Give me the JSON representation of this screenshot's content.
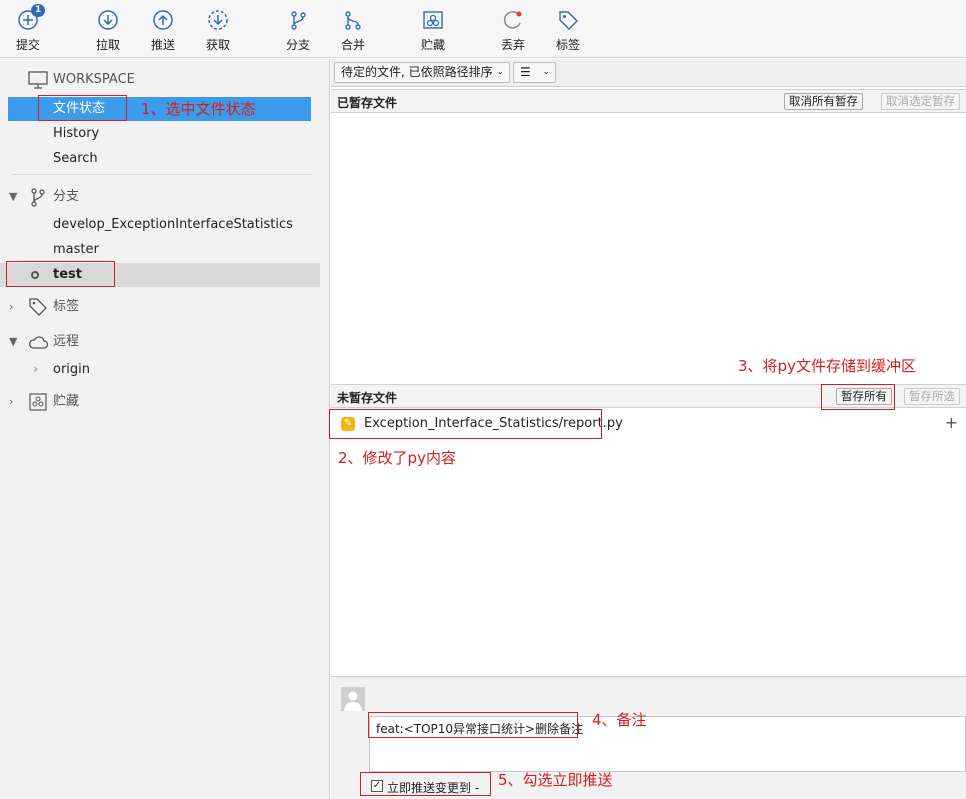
{
  "toolbar": {
    "commit": {
      "label": "提交",
      "badge": "1"
    },
    "pull": "拉取",
    "push": "推送",
    "fetch": "获取",
    "branch": "分支",
    "merge": "合并",
    "stash": "贮藏",
    "discard": "丢弃",
    "tag": "标签"
  },
  "sidebar": {
    "workspace": "WORKSPACE",
    "file_status": "文件状态",
    "history": "History",
    "search": "Search",
    "branches_header": "分支",
    "branches": [
      "develop_ExceptionInterfaceStatistics",
      "master",
      "test"
    ],
    "tags_header": "标签",
    "remotes_header": "远程",
    "origin": "origin",
    "stashes_header": "贮藏"
  },
  "filter": {
    "sort_label": "待定的文件, 已依照路径排序",
    "view_icon": "list-icon"
  },
  "staged": {
    "title": "已暂存文件",
    "unstage_all": "取消所有暂存",
    "unstage_selected": "取消选定暂存"
  },
  "unstaged": {
    "title": "未暂存文件",
    "stage_all": "暂存所有",
    "stage_selected": "暂存所选",
    "file": "Exception_Interface_Statistics/report.py"
  },
  "commit": {
    "message": "feat:<TOP10异常接口统计>删除备注",
    "push_checkbox": "立即推送变更到 -"
  },
  "annotations": {
    "a1": "1、选中文件状态",
    "a2": "2、修改了py内容",
    "a3": "3、将py文件存储到缓冲区",
    "a4": "4、备注",
    "a5": "5、勾选立即推送"
  },
  "colors": {
    "selected": "#3d9bec",
    "annotation": "#d02020",
    "accent": "#2a6db5"
  }
}
